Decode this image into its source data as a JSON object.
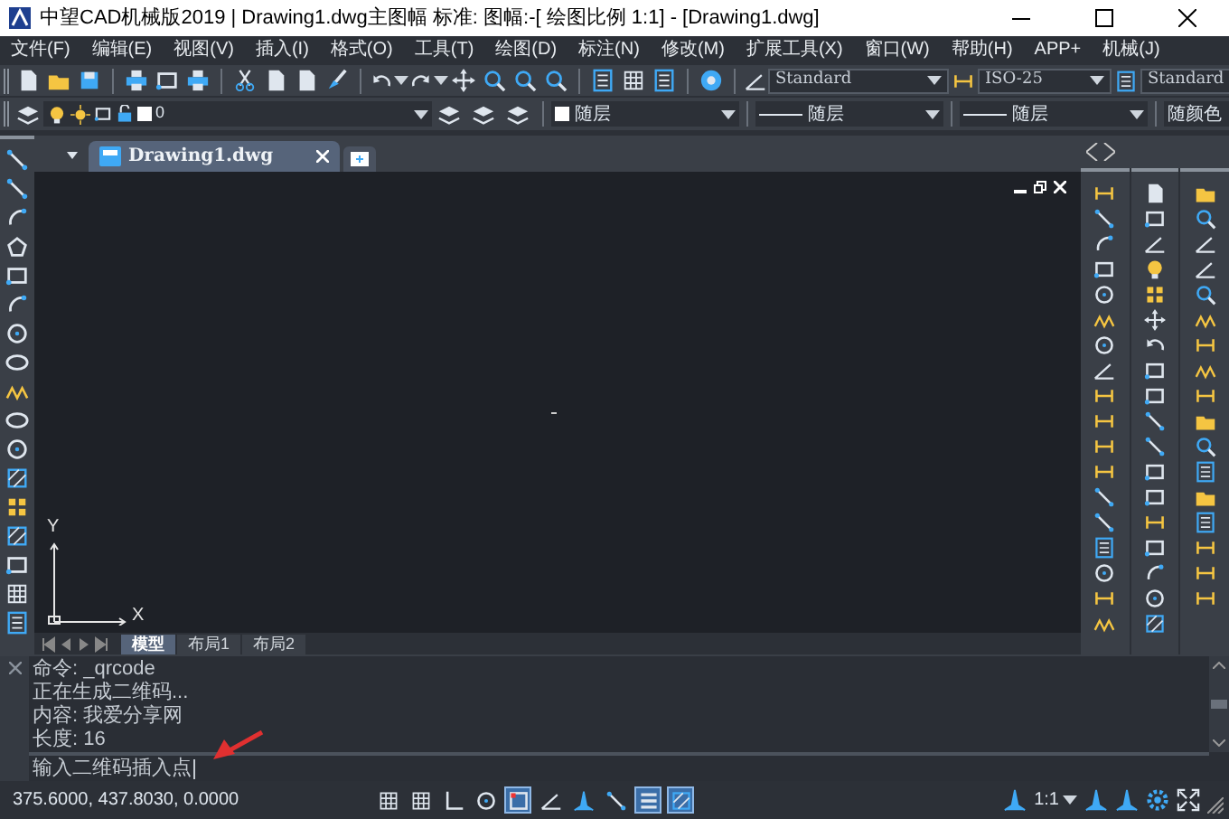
{
  "window": {
    "title": "中望CAD机械版2019 | Drawing1.dwg主图幅  标准: 图幅:-[ 绘图比例 1:1] - [Drawing1.dwg]"
  },
  "menu": [
    "文件(F)",
    "编辑(E)",
    "视图(V)",
    "插入(I)",
    "格式(O)",
    "工具(T)",
    "绘图(D)",
    "标注(N)",
    "修改(M)",
    "扩展工具(X)",
    "窗口(W)",
    "帮助(H)",
    "APP+",
    "机械(J)"
  ],
  "style_toolbar": {
    "text_style": "Standard",
    "dim_style": "ISO-25",
    "table_style": "Standard"
  },
  "properties_toolbar": {
    "layer": "0",
    "color_control": "随层",
    "linetype": "随层",
    "lineweight": "随层",
    "plot_style": "随颜色"
  },
  "document_tabs": [
    {
      "label": "Drawing1.dwg",
      "selected": true
    }
  ],
  "axis_labels": {
    "y": "Y",
    "x": "X"
  },
  "layout_tabs": [
    {
      "label": "模型",
      "selected": true
    },
    {
      "label": "布局1",
      "selected": false
    },
    {
      "label": "布局2",
      "selected": false
    }
  ],
  "command_history": [
    "命令: _qrcode",
    "正在生成二维码...",
    "内容: 我爱分享网",
    "长度: 16"
  ],
  "command_prompt": "输入二维码插入点",
  "status_bar": {
    "coordinates": "375.6000, 437.8030, 0.0000",
    "annotation_scale": "1:1",
    "toggles": [
      {
        "on": false
      },
      {
        "on": false
      },
      {
        "on": false
      },
      {
        "on": false
      },
      {
        "on": true
      },
      {
        "on": false
      },
      {
        "on": false
      },
      {
        "on": false
      },
      {
        "on": true
      },
      {
        "on": true
      }
    ]
  }
}
